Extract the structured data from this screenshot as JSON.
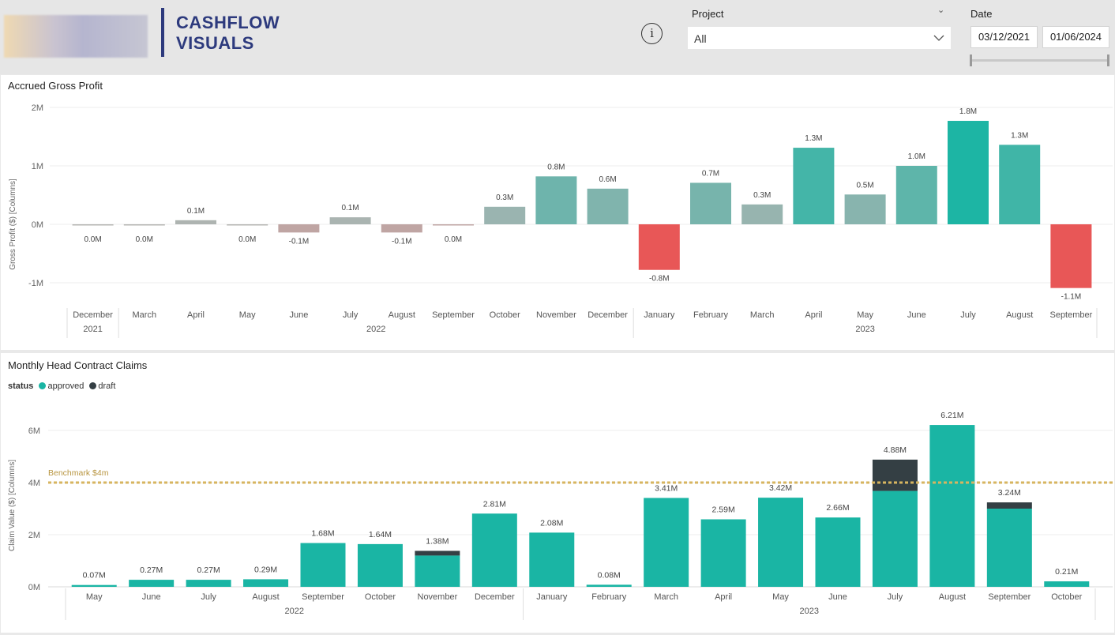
{
  "header": {
    "title_line1": "CASHFLOW",
    "title_line2": "VISUALS",
    "info_icon": "info-icon"
  },
  "filters": {
    "project_label": "Project",
    "project_value": "All",
    "date_label": "Date",
    "date_start": "03/12/2021",
    "date_end": "01/06/2024"
  },
  "colors": {
    "brand": "#2d3a7d",
    "teal": "#1ab5a4",
    "negative": "#e85757",
    "draft": "#343f44",
    "benchmark": "#d7b560"
  },
  "chart_data": [
    {
      "title": "Accrued Gross Profit",
      "type": "bar",
      "ylabel": "Gross Profit ($) [Columns]",
      "ylim": [
        -1.5,
        2.2
      ],
      "yticks": [
        {
          "v": 2,
          "label": "2M"
        },
        {
          "v": 1,
          "label": "1M"
        },
        {
          "v": 0,
          "label": "0M"
        },
        {
          "v": -1,
          "label": "-1M"
        }
      ],
      "categories": [
        "December",
        "March",
        "April",
        "May",
        "June",
        "July",
        "August",
        "September",
        "October",
        "November",
        "December",
        "January",
        "February",
        "March",
        "April",
        "May",
        "June",
        "July",
        "August",
        "September"
      ],
      "years": [
        {
          "label": "2021",
          "from": 0,
          "to": 0
        },
        {
          "label": "2022",
          "from": 1,
          "to": 10
        },
        {
          "label": "2023",
          "from": 11,
          "to": 19
        }
      ],
      "values": [
        0.0,
        0.0,
        0.07,
        0.0,
        -0.14,
        0.12,
        -0.14,
        -0.02,
        0.3,
        0.82,
        0.61,
        -0.78,
        0.71,
        0.34,
        1.31,
        0.51,
        1.0,
        1.77,
        1.36,
        -1.09
      ],
      "labels": [
        "0.0M",
        "0.0M",
        "0.1M",
        "0.0M",
        "-0.1M",
        "0.1M",
        "-0.1M",
        "0.0M",
        "0.3M",
        "0.8M",
        "0.6M",
        "-0.8M",
        "0.7M",
        "0.3M",
        "1.3M",
        "0.5M",
        "1.0M",
        "1.8M",
        "1.3M",
        "-1.1M"
      ],
      "grid": true
    },
    {
      "title": "Monthly Head Contract Claims",
      "type": "bar",
      "stacked": true,
      "ylabel": "Claim Value ($) [Columns]",
      "legend_title": "status",
      "ylim": [
        0,
        7
      ],
      "yticks": [
        {
          "v": 6,
          "label": "6M"
        },
        {
          "v": 4,
          "label": "4M"
        },
        {
          "v": 2,
          "label": "2M"
        },
        {
          "v": 0,
          "label": "0M"
        }
      ],
      "categories": [
        "May",
        "June",
        "July",
        "August",
        "September",
        "October",
        "November",
        "December",
        "January",
        "February",
        "March",
        "April",
        "May",
        "June",
        "July",
        "August",
        "September",
        "October"
      ],
      "years": [
        {
          "label": "2022",
          "from": 0,
          "to": 7
        },
        {
          "label": "2023",
          "from": 8,
          "to": 17
        }
      ],
      "series": [
        {
          "name": "approved",
          "values": [
            0.07,
            0.27,
            0.27,
            0.29,
            1.68,
            1.64,
            1.2,
            2.81,
            2.08,
            0.08,
            3.41,
            2.59,
            3.42,
            2.66,
            3.68,
            6.21,
            3.0,
            0.21
          ]
        },
        {
          "name": "draft",
          "values": [
            0,
            0,
            0,
            0,
            0,
            0,
            0.18,
            0,
            0,
            0,
            0,
            0,
            0,
            0,
            1.2,
            0,
            0.24,
            0
          ]
        }
      ],
      "labels": [
        "0.07M",
        "0.27M",
        "0.27M",
        "0.29M",
        "1.68M",
        "1.64M",
        "1.38M",
        "2.81M",
        "2.08M",
        "0.08M",
        "3.41M",
        "2.59M",
        "3.42M",
        "2.66M",
        "4.88M",
        "6.21M",
        "3.24M",
        "0.21M"
      ],
      "benchmark": {
        "value": 4,
        "label": "Benchmark $4m"
      },
      "grid": true
    }
  ]
}
